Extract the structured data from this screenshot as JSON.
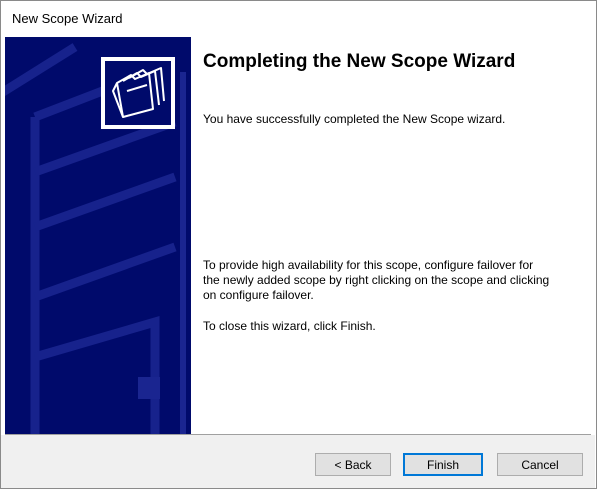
{
  "window": {
    "title": "New Scope Wizard"
  },
  "banner": {
    "logo_icon": "folders-icon",
    "bg_color": "#000a6b"
  },
  "content": {
    "heading": "Completing the New Scope Wizard",
    "success_text": "You have successfully completed the New Scope wizard.",
    "failover_text": "To provide high availability for this scope, configure failover for the newly added scope by right clicking on the scope and clicking on configure failover.",
    "close_text": "To close this wizard, click Finish."
  },
  "buttons": {
    "back": "< Back",
    "finish": "Finish",
    "cancel": "Cancel"
  }
}
